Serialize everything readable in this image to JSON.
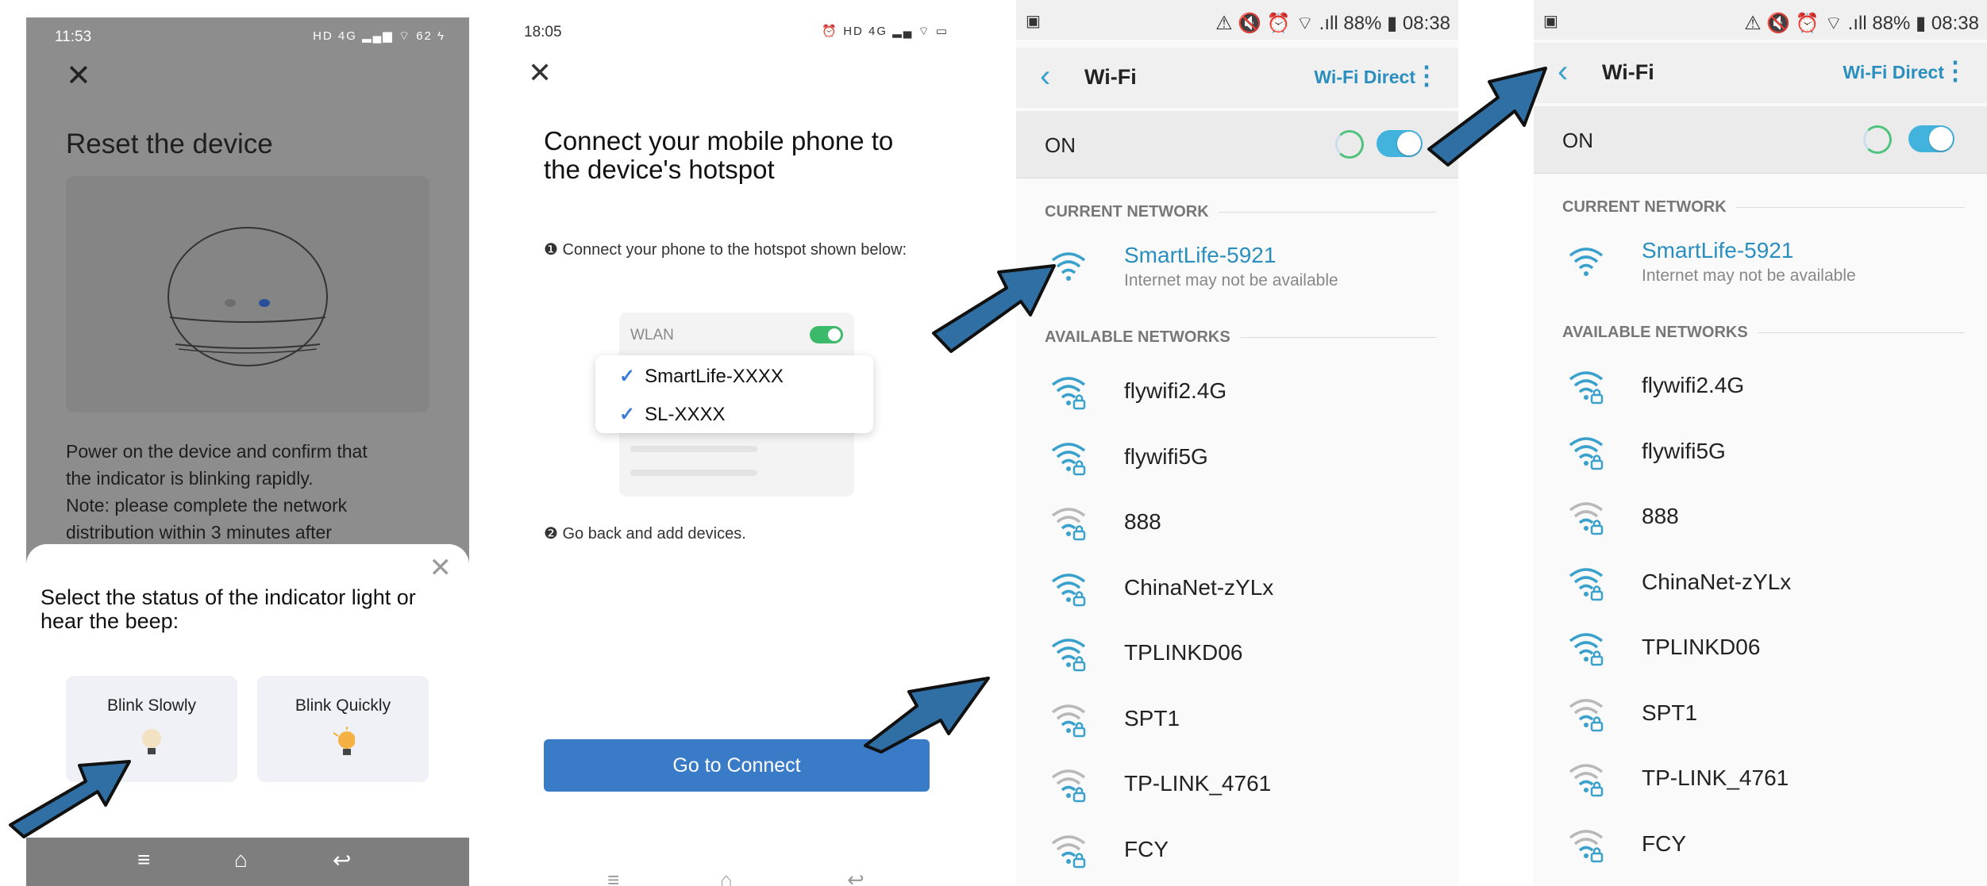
{
  "panel1": {
    "status_time": "11:53",
    "status_icons": "HD 4G ▂▄▆ ⌔ 62 ϟ",
    "title": "Reset the device",
    "description_lines": [
      "Power on the device and confirm that",
      "the indicator is blinking rapidly.",
      "Note: please complete the network",
      "distribution within 3 minutes after"
    ],
    "sheet_question": "Select the status of the indicator light or hear the beep:",
    "option_slow": "Blink Slowly",
    "option_quick": "Blink Quickly",
    "nav": {
      "menu": "≡",
      "home": "⌂",
      "back": "↩"
    }
  },
  "panel2": {
    "status_time": "18:05",
    "status_icons": "⏰ HD 4G ▂▄ ⌔ ▭",
    "title": "Connect your mobile phone to the device's hotspot",
    "step1": "❶ Connect your phone to the hotspot shown below:",
    "wlan_label": "WLAN",
    "hotspots": [
      "SmartLife-XXXX",
      "SL-XXXX"
    ],
    "step2": "❷ Go back and add devices.",
    "connect_button": "Go to Connect"
  },
  "wifi_screen": {
    "status_left": "▣",
    "status_right": "⚠ 🔇 ⏰ ⌔ .ıll 88% ▮ 08:38",
    "title": "Wi-Fi",
    "direct": "Wi-Fi Direct",
    "more": "⋮",
    "on_label": "ON",
    "current_header": "CURRENT NETWORK",
    "current_network": {
      "name": "SmartLife-5921",
      "status": "Internet may not be available"
    },
    "available_header": "AVAILABLE NETWORKS",
    "networks": [
      {
        "name": "flywifi2.4G",
        "strength": "strong"
      },
      {
        "name": "flywifi5G",
        "strength": "strong"
      },
      {
        "name": "888",
        "strength": "weak"
      },
      {
        "name": "ChinaNet-zYLx",
        "strength": "strong"
      },
      {
        "name": "TPLINKD06",
        "strength": "strong"
      },
      {
        "name": "SPT1",
        "strength": "weak"
      },
      {
        "name": "TP-LINK_4761",
        "strength": "weak"
      },
      {
        "name": "FCY",
        "strength": "weak"
      }
    ]
  },
  "colors": {
    "accent": "#2a8fbf",
    "toggle": "#42b3dd",
    "button": "#3a7bc8",
    "arrow": "#2f6fa3"
  }
}
